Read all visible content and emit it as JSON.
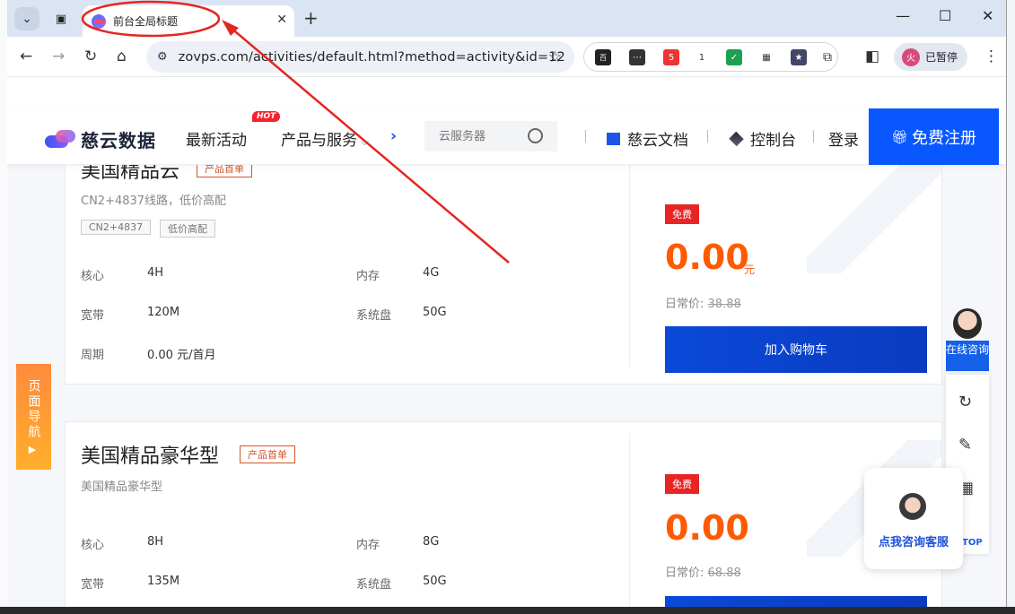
{
  "browser": {
    "tab_title": "前台全局标题",
    "url": "zovps.com/activities/default.html?method=activity&id=12",
    "profile_initial": "火",
    "profile_label": "已暂停",
    "ext_badges": [
      "5",
      "1"
    ]
  },
  "site": {
    "logo_text": "慈云数据",
    "menu": {
      "latest": "最新活动",
      "hot_badge": "HOT",
      "products": "产品与服务"
    },
    "search_placeholder": "云服务器",
    "docs_link": "慈云文档",
    "console_link": "控制台",
    "login_link": "登录",
    "register_button": "免费注册"
  },
  "products": [
    {
      "name": "美国精品云",
      "badge": "产品首单",
      "desc": "CN2+4837线路，低价高配",
      "chips": [
        "CN2+4837",
        "低价高配"
      ],
      "specs": {
        "cpu_label": "核心",
        "cpu": "4H",
        "ram_label": "内存",
        "ram": "4G",
        "bw_label": "宽带",
        "bw": "120M",
        "disk_label": "系统盘",
        "disk": "50G",
        "period_label": "周期",
        "period": "0.00 元/首月"
      },
      "free_label": "免费",
      "price": "0.00",
      "unit": "元",
      "orig_label": "日常价:",
      "orig_price": "38.88",
      "cart": "加入购物车"
    },
    {
      "name": "美国精品豪华型",
      "badge": "产品首单",
      "desc": "美国精品豪华型",
      "specs": {
        "cpu_label": "核心",
        "cpu": "8H",
        "ram_label": "内存",
        "ram": "8G",
        "bw_label": "宽带",
        "bw": "135M",
        "disk_label": "系统盘",
        "disk": "50G"
      },
      "free_label": "免费",
      "price": "0.00",
      "orig_label": "日常价:",
      "orig_price": "68.88"
    }
  ],
  "widgets": {
    "page_nav": "页面导航",
    "online_agent": "在线咨询",
    "consult_popup": "点我咨询客服",
    "top_label": "TOP"
  },
  "annotation": {
    "color": "#e5261f"
  }
}
